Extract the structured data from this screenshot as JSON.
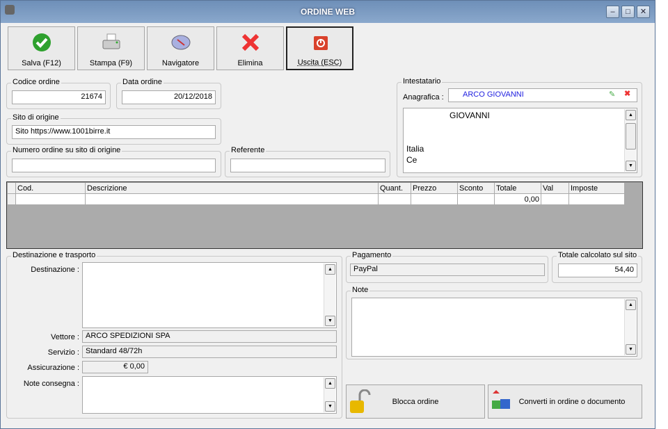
{
  "window": {
    "title": "ORDINE WEB",
    "minimize": "–",
    "maximize": "□",
    "close": "✕"
  },
  "toolbar": [
    {
      "label": "Salva (F12)",
      "icon": "check-icon"
    },
    {
      "label": "Stampa (F9)",
      "icon": "printer-icon"
    },
    {
      "label": "Navigatore",
      "icon": "compass-icon"
    },
    {
      "label": "Elimina",
      "icon": "x-icon"
    },
    {
      "label": "Uscita (ESC)",
      "icon": "power-icon"
    }
  ],
  "codice": {
    "label": "Codice ordine",
    "value": "21674"
  },
  "data": {
    "label": "Data ordine",
    "value": "20/12/2018"
  },
  "sito": {
    "label": "Sito di origine",
    "value": "Sito https://www.1001birre.it"
  },
  "numero": {
    "label": "Numero ordine su sito di origine",
    "value": ""
  },
  "referente": {
    "label": "Referente",
    "value": ""
  },
  "intestatario": {
    "label": "Intestatario",
    "anagrafica_label": "Anagrafica :",
    "anagrafica_value": "ARCO GIOVANNI",
    "address": [
      "GIOVANNI",
      "",
      "",
      "Italia",
      "Ce"
    ]
  },
  "grid": {
    "columns": [
      "Cod.",
      "Descrizione",
      "Quant.",
      "Prezzo",
      "Sconto",
      "Totale",
      "Val",
      "Imposte"
    ],
    "rows": [
      [
        "",
        "",
        "",
        "",
        "",
        "0,00",
        "",
        ""
      ]
    ]
  },
  "destinazione": {
    "label": "Destinazione e trasporto",
    "dest_label": "Destinazione :",
    "vettore_label": "Vettore :",
    "vettore": "ARCO SPEDIZIONI SPA",
    "servizio_label": "Servizio :",
    "servizio": "Standard 48/72h",
    "assic_label": "Assicurazione :",
    "assic": "€ 0,00",
    "note_label": "Note consegna :"
  },
  "pagamento": {
    "label": "Pagamento",
    "value": "PayPal"
  },
  "totale": {
    "label": "Totale calcolato sul sito",
    "value": "54,40"
  },
  "note": {
    "label": "Note"
  },
  "actions": {
    "blocca": "Blocca ordine",
    "converti": "Converti in ordine o documento"
  }
}
